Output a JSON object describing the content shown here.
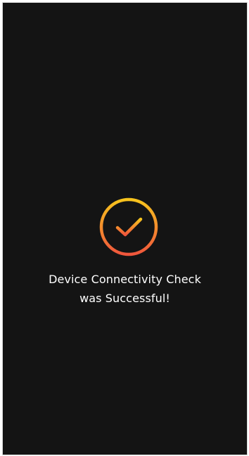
{
  "success": {
    "icon": "check-circle-icon",
    "message_line1": "Device Connectivity Check",
    "message_line2": "was Successful!"
  },
  "colors": {
    "background": "#141414",
    "text": "#ffffff",
    "icon_gradient_top": "#f7c41d",
    "icon_gradient_bottom": "#f0563c"
  }
}
